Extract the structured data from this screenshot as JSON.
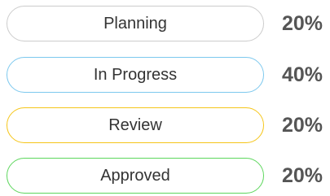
{
  "statuses": [
    {
      "label": "Planning",
      "percent": "20%",
      "color": "#cccccc"
    },
    {
      "label": "In Progress",
      "percent": "40%",
      "color": "#7cc8ee"
    },
    {
      "label": "Review",
      "percent": "20%",
      "color": "#f5c518"
    },
    {
      "label": "Approved",
      "percent": "20%",
      "color": "#5cd65c"
    }
  ]
}
